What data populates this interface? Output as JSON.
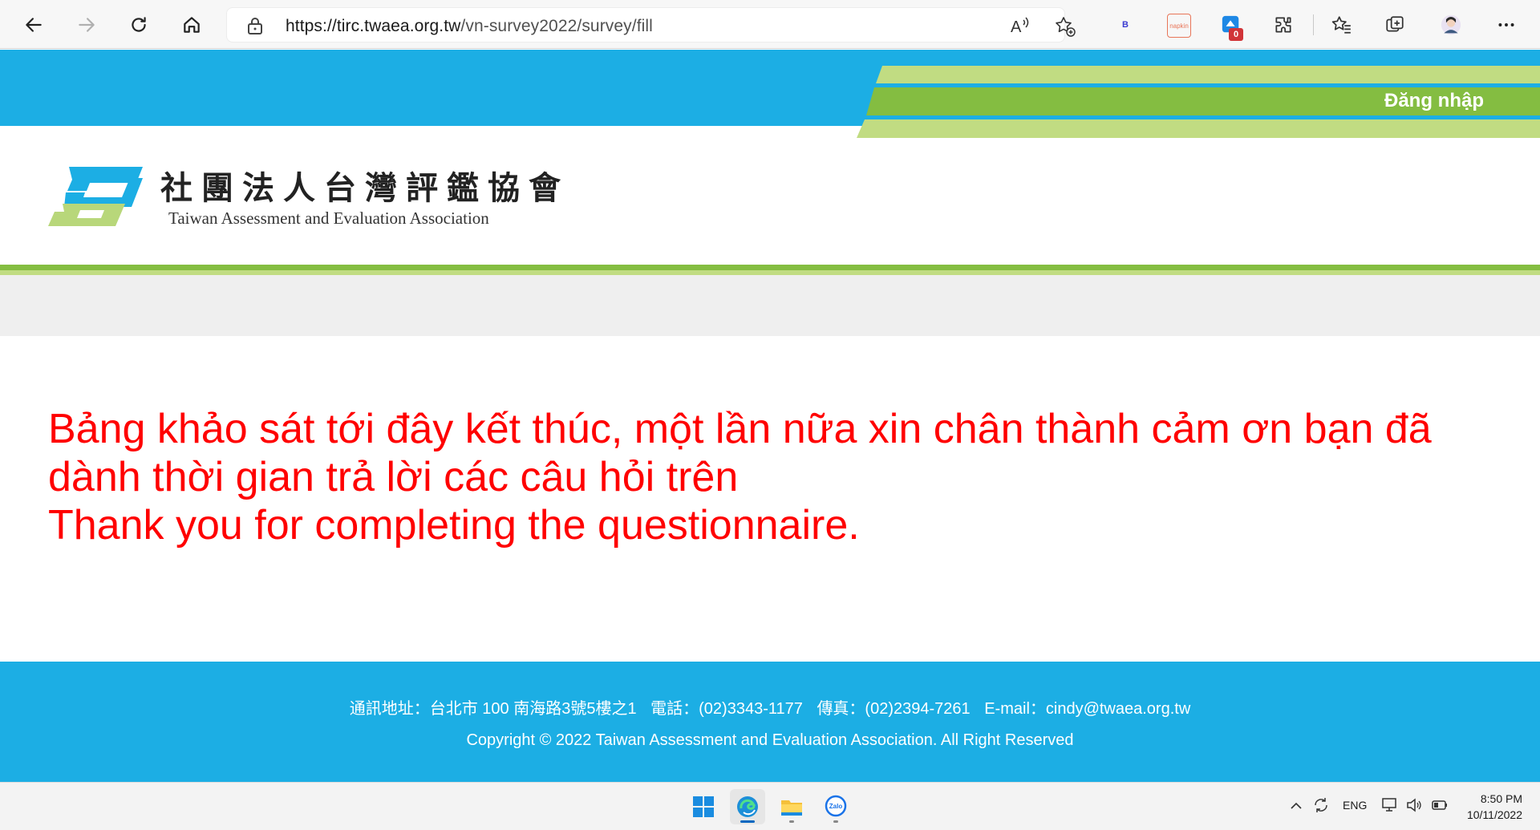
{
  "browser": {
    "url_host": "https://tirc.twaea.org.tw",
    "url_path": "/vn-survey2022/survey/fill",
    "badge_count": "0",
    "ext_b_label": "B",
    "ext_napkin_label": "napkin",
    "icons": [
      "back-arrow-icon",
      "forward-arrow-icon",
      "refresh-icon",
      "home-icon",
      "lock-icon",
      "read-aloud-icon",
      "add-favorite-icon",
      "extensions-icon",
      "favorites-icon",
      "collections-icon",
      "profile-avatar",
      "more-icon"
    ]
  },
  "header": {
    "login_label": "Đăng nhập",
    "logo_cn": "社團法人台灣評鑑協會",
    "logo_en": "Taiwan Assessment and Evaluation Association",
    "colors": {
      "blue": "#1caee4",
      "green": "#84bd41",
      "light_green": "#c1dc82"
    }
  },
  "main": {
    "message_vi": "Bảng khảo sát tới đây kết thúc, một lần nữa xin chân thành cảm ơn bạn đã dành thời gian trả lời các câu hỏi trên",
    "message_en": "Thank you for completing the questionnaire.",
    "message_color": "#ff0000"
  },
  "footer": {
    "address": "通訊地址：台北市 100 南海路3號5樓之1",
    "phone": "電話：(02)3343-1177",
    "fax": "傳真：(02)2394-7261",
    "email": "E-mail：cindy@twaea.org.tw",
    "copyright": "Copyright © 2022 Taiwan Assessment and Evaluation Association. All Right Reserved"
  },
  "taskbar": {
    "apps": [
      "windows-start-icon",
      "edge-icon",
      "file-explorer-icon",
      "zalo-icon"
    ],
    "zalo_label": "Zalo",
    "language": "ENG",
    "time": "8:50 PM",
    "date": "10/11/2022"
  }
}
